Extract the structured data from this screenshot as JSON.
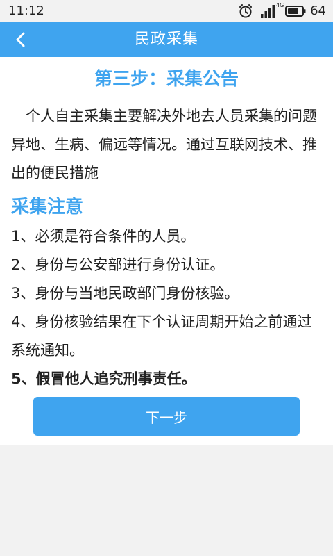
{
  "status_bar": {
    "time": "11:12",
    "network": "4G",
    "battery": "64",
    "icons": [
      "alarm-icon",
      "signal-icon",
      "battery-icon"
    ]
  },
  "header": {
    "back_icon": "chevron-left-icon",
    "title": "民政采集"
  },
  "content": {
    "step_title": "第三步：采集公告",
    "intro": "个人自主采集主要解决外地去人员采集的问题异地、生病、偏远等情况。通过互联网技术、推出的便民措施",
    "notice_title": "采集注意",
    "rules": [
      "1、必须是符合条件的人员。",
      "2、身份与公安部进行身份认证。",
      "3、身份与当地民政部门身份核验。",
      "4、身份核验结果在下个认证周期开始之前通过系统通知。",
      "5、假冒他人追究刑事责任。"
    ],
    "next_label": "下一步"
  },
  "colors": {
    "accent": "#3fa4ef",
    "background": "#f2f2f2",
    "card": "#ffffff",
    "text": "#222222"
  }
}
